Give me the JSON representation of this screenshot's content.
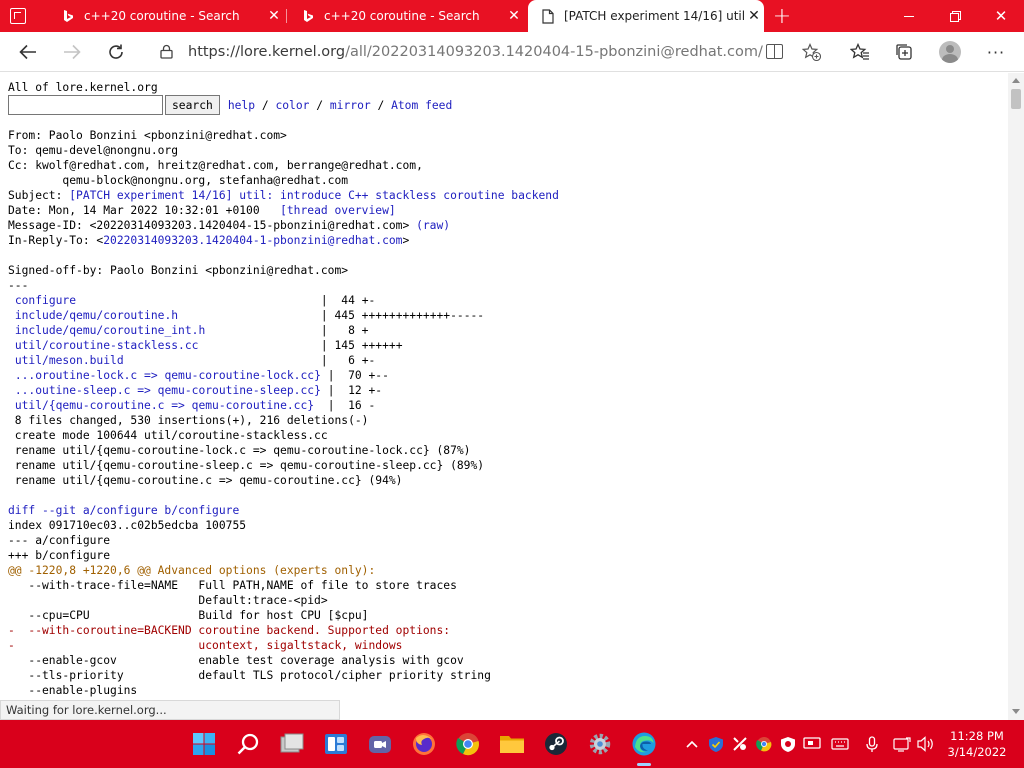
{
  "tabs": [
    {
      "title": "c++20 coroutine - Search",
      "favicon": "bing-icon"
    },
    {
      "title": "c++20 coroutine - Search",
      "favicon": "bing-icon"
    },
    {
      "title": "[PATCH experiment 14/16] util: in",
      "favicon": "page-icon"
    }
  ],
  "new_tab_label": "+",
  "address": {
    "url_host": "https://lore.kernel.org",
    "url_path": "/all/20220314093203.1420404-15-pbonzini@redhat.com/"
  },
  "page": {
    "site_title": "All of lore.kernel.org",
    "search_value": "",
    "search_button": "search",
    "nav": {
      "help": "help",
      "color": "color",
      "mirror": "mirror",
      "atom": "Atom feed"
    },
    "nav_sep": " / ",
    "headers": {
      "from": "From: Paolo Bonzini <pbonzini@redhat.com>",
      "to": "To: qemu-devel@nongnu.org",
      "cc1": "Cc: kwolf@redhat.com, hreitz@redhat.com, berrange@redhat.com,",
      "cc2": "        qemu-block@nongnu.org, stefanha@redhat.com",
      "subject_label": "Subject: ",
      "subject": "[PATCH experiment 14/16] util: introduce C++ stackless coroutine backend",
      "date": "Date: Mon, 14 Mar 2022 10:32:01 +0100   ",
      "thread_overview": "[thread overview]",
      "message_id_label": "Message-ID: <20220314093203.1420404-15-pbonzini@redhat.com> ",
      "raw": "(raw)",
      "in_reply_to_label": "In-Reply-To: <",
      "in_reply_to": "20220314093203.1420404-1-pbonzini@redhat.com",
      "in_reply_to_end": ">"
    },
    "signed_off": "Signed-off-by: Paolo Bonzini <pbonzini@redhat.com>",
    "dashes": "---",
    "diffstat": [
      {
        "file": "configure",
        "pad": "                                    ",
        "stat": "|  44 +-"
      },
      {
        "file": "include/qemu/coroutine.h",
        "pad": "                     ",
        "stat": "| 445 +++++++++++++-----"
      },
      {
        "file": "include/qemu/coroutine_int.h",
        "pad": "                 ",
        "stat": "|   8 +"
      },
      {
        "file": "util/coroutine-stackless.cc",
        "pad": "                  ",
        "stat": "| 145 ++++++"
      },
      {
        "file": "util/meson.build",
        "pad": "                             ",
        "stat": "|   6 +-"
      },
      {
        "file": "...oroutine-lock.c => qemu-coroutine-lock.cc}",
        "pad": " ",
        "stat": "|  70 +--"
      },
      {
        "file": "...outine-sleep.c => qemu-coroutine-sleep.cc}",
        "pad": " ",
        "stat": "|  12 +-"
      },
      {
        "file": "util/{qemu-coroutine.c => qemu-coroutine.cc}",
        "pad": "  ",
        "stat": "|  16 -"
      }
    ],
    "summary": [
      " 8 files changed, 530 insertions(+), 216 deletions(-)",
      " create mode 100644 util/coroutine-stackless.cc",
      " rename util/{qemu-coroutine-lock.c => qemu-coroutine-lock.cc} (87%)",
      " rename util/{qemu-coroutine-sleep.c => qemu-coroutine-sleep.cc} (89%)",
      " rename util/{qemu-coroutine.c => qemu-coroutine.cc} (94%)"
    ],
    "diff_header": "diff --git a/configure b/configure",
    "index_line": "index 091710ec03..c02b5edcba 100755",
    "minus_file": "--- a/configure",
    "plus_file": "+++ b/configure",
    "hunk": "@@ -1220,8 +1220,6 @@ Advanced options (experts only):",
    "diff_lines": [
      {
        "type": "ctx",
        "text": "   --with-trace-file=NAME   Full PATH,NAME of file to store traces"
      },
      {
        "type": "ctx",
        "text": "                            Default:trace-<pid>"
      },
      {
        "type": "ctx",
        "text": "   --cpu=CPU                Build for host CPU [$cpu]"
      },
      {
        "type": "del",
        "text": "-  --with-coroutine=BACKEND coroutine backend. Supported options:"
      },
      {
        "type": "del",
        "text": "-                           ucontext, sigaltstack, windows"
      },
      {
        "type": "ctx",
        "text": "   --enable-gcov            enable test coverage analysis with gcov"
      },
      {
        "type": "ctx",
        "text": "   --tls-priority           default TLS protocol/cipher priority string"
      },
      {
        "type": "ctx",
        "text": "   --enable-plugins"
      }
    ]
  },
  "status_text": "Waiting for lore.kernel.org...",
  "clock": {
    "time": "11:28 PM",
    "date": "3/14/2022"
  },
  "colors": {
    "accent": "#e81123",
    "taskbar": "#d9001b",
    "link": "#2020c0"
  }
}
